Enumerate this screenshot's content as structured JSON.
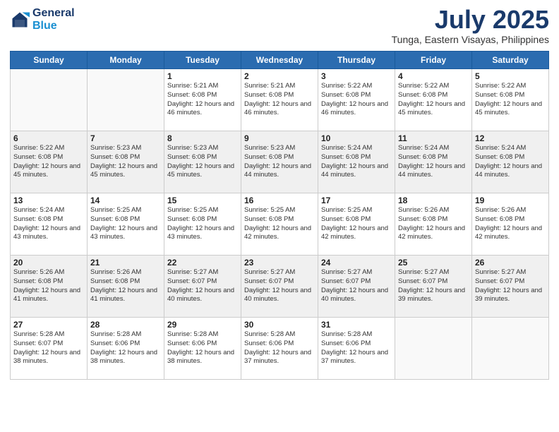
{
  "logo": {
    "general": "General",
    "blue": "Blue"
  },
  "title": "July 2025",
  "subtitle": "Tunga, Eastern Visayas, Philippines",
  "headers": [
    "Sunday",
    "Monday",
    "Tuesday",
    "Wednesday",
    "Thursday",
    "Friday",
    "Saturday"
  ],
  "weeks": [
    [
      {
        "day": "",
        "info": ""
      },
      {
        "day": "",
        "info": ""
      },
      {
        "day": "1",
        "info": "Sunrise: 5:21 AM\nSunset: 6:08 PM\nDaylight: 12 hours and 46 minutes."
      },
      {
        "day": "2",
        "info": "Sunrise: 5:21 AM\nSunset: 6:08 PM\nDaylight: 12 hours and 46 minutes."
      },
      {
        "day": "3",
        "info": "Sunrise: 5:22 AM\nSunset: 6:08 PM\nDaylight: 12 hours and 46 minutes."
      },
      {
        "day": "4",
        "info": "Sunrise: 5:22 AM\nSunset: 6:08 PM\nDaylight: 12 hours and 45 minutes."
      },
      {
        "day": "5",
        "info": "Sunrise: 5:22 AM\nSunset: 6:08 PM\nDaylight: 12 hours and 45 minutes."
      }
    ],
    [
      {
        "day": "6",
        "info": "Sunrise: 5:22 AM\nSunset: 6:08 PM\nDaylight: 12 hours and 45 minutes."
      },
      {
        "day": "7",
        "info": "Sunrise: 5:23 AM\nSunset: 6:08 PM\nDaylight: 12 hours and 45 minutes."
      },
      {
        "day": "8",
        "info": "Sunrise: 5:23 AM\nSunset: 6:08 PM\nDaylight: 12 hours and 45 minutes."
      },
      {
        "day": "9",
        "info": "Sunrise: 5:23 AM\nSunset: 6:08 PM\nDaylight: 12 hours and 44 minutes."
      },
      {
        "day": "10",
        "info": "Sunrise: 5:24 AM\nSunset: 6:08 PM\nDaylight: 12 hours and 44 minutes."
      },
      {
        "day": "11",
        "info": "Sunrise: 5:24 AM\nSunset: 6:08 PM\nDaylight: 12 hours and 44 minutes."
      },
      {
        "day": "12",
        "info": "Sunrise: 5:24 AM\nSunset: 6:08 PM\nDaylight: 12 hours and 44 minutes."
      }
    ],
    [
      {
        "day": "13",
        "info": "Sunrise: 5:24 AM\nSunset: 6:08 PM\nDaylight: 12 hours and 43 minutes."
      },
      {
        "day": "14",
        "info": "Sunrise: 5:25 AM\nSunset: 6:08 PM\nDaylight: 12 hours and 43 minutes."
      },
      {
        "day": "15",
        "info": "Sunrise: 5:25 AM\nSunset: 6:08 PM\nDaylight: 12 hours and 43 minutes."
      },
      {
        "day": "16",
        "info": "Sunrise: 5:25 AM\nSunset: 6:08 PM\nDaylight: 12 hours and 42 minutes."
      },
      {
        "day": "17",
        "info": "Sunrise: 5:25 AM\nSunset: 6:08 PM\nDaylight: 12 hours and 42 minutes."
      },
      {
        "day": "18",
        "info": "Sunrise: 5:26 AM\nSunset: 6:08 PM\nDaylight: 12 hours and 42 minutes."
      },
      {
        "day": "19",
        "info": "Sunrise: 5:26 AM\nSunset: 6:08 PM\nDaylight: 12 hours and 42 minutes."
      }
    ],
    [
      {
        "day": "20",
        "info": "Sunrise: 5:26 AM\nSunset: 6:08 PM\nDaylight: 12 hours and 41 minutes."
      },
      {
        "day": "21",
        "info": "Sunrise: 5:26 AM\nSunset: 6:08 PM\nDaylight: 12 hours and 41 minutes."
      },
      {
        "day": "22",
        "info": "Sunrise: 5:27 AM\nSunset: 6:07 PM\nDaylight: 12 hours and 40 minutes."
      },
      {
        "day": "23",
        "info": "Sunrise: 5:27 AM\nSunset: 6:07 PM\nDaylight: 12 hours and 40 minutes."
      },
      {
        "day": "24",
        "info": "Sunrise: 5:27 AM\nSunset: 6:07 PM\nDaylight: 12 hours and 40 minutes."
      },
      {
        "day": "25",
        "info": "Sunrise: 5:27 AM\nSunset: 6:07 PM\nDaylight: 12 hours and 39 minutes."
      },
      {
        "day": "26",
        "info": "Sunrise: 5:27 AM\nSunset: 6:07 PM\nDaylight: 12 hours and 39 minutes."
      }
    ],
    [
      {
        "day": "27",
        "info": "Sunrise: 5:28 AM\nSunset: 6:07 PM\nDaylight: 12 hours and 38 minutes."
      },
      {
        "day": "28",
        "info": "Sunrise: 5:28 AM\nSunset: 6:06 PM\nDaylight: 12 hours and 38 minutes."
      },
      {
        "day": "29",
        "info": "Sunrise: 5:28 AM\nSunset: 6:06 PM\nDaylight: 12 hours and 38 minutes."
      },
      {
        "day": "30",
        "info": "Sunrise: 5:28 AM\nSunset: 6:06 PM\nDaylight: 12 hours and 37 minutes."
      },
      {
        "day": "31",
        "info": "Sunrise: 5:28 AM\nSunset: 6:06 PM\nDaylight: 12 hours and 37 minutes."
      },
      {
        "day": "",
        "info": ""
      },
      {
        "day": "",
        "info": ""
      }
    ]
  ]
}
